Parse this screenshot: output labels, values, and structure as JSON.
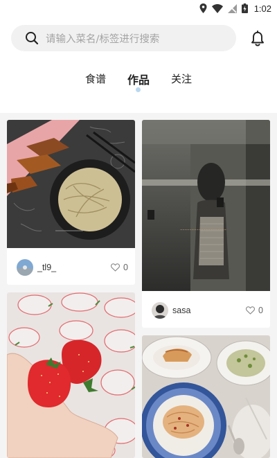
{
  "status_bar": {
    "time": "1:02"
  },
  "search": {
    "placeholder": "请输入菜名/标签进行搜索"
  },
  "tabs": [
    {
      "label": "食谱",
      "active": false
    },
    {
      "label": "作品",
      "active": true
    },
    {
      "label": "关注",
      "active": false
    }
  ],
  "feed": [
    {
      "author": "_tl9_",
      "likes": "0",
      "photo_desc": "tea-marinated noodles and roasted sweet potatoes"
    },
    {
      "author": "sasa",
      "likes": "0",
      "photo_desc": "mirror selfie"
    },
    {
      "author": "",
      "likes": "",
      "photo_desc": "hand holding strawberries"
    },
    {
      "author": "",
      "likes": "",
      "photo_desc": "pasta dishes on a table"
    }
  ],
  "colors": {
    "accent_dot": "#b9d8ef",
    "background": "#f4f4f4"
  }
}
